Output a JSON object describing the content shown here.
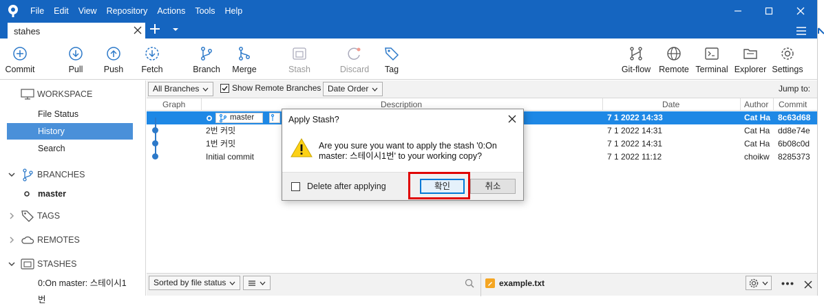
{
  "menu": [
    "File",
    "Edit",
    "View",
    "Repository",
    "Actions",
    "Tools",
    "Help"
  ],
  "tab": {
    "label": "stahes"
  },
  "toolbar": {
    "commit": "Commit",
    "pull": "Pull",
    "push": "Push",
    "fetch": "Fetch",
    "branch": "Branch",
    "merge": "Merge",
    "stash": "Stash",
    "discard": "Discard",
    "tag": "Tag",
    "gitflow": "Git-flow",
    "remote": "Remote",
    "terminal": "Terminal",
    "explorer": "Explorer",
    "settings": "Settings"
  },
  "sidebar": {
    "workspace": "WORKSPACE",
    "file_status": "File Status",
    "history": "History",
    "search": "Search",
    "branches": "BRANCHES",
    "master": "master",
    "tags": "TAGS",
    "remotes": "REMOTES",
    "stashes": "STASHES",
    "stash_item": "0:On master: 스테이시1번"
  },
  "filter": {
    "all_branches": "All Branches",
    "show_remote": "Show Remote Branches",
    "date_order": "Date Order",
    "jump_to": "Jump to:"
  },
  "columns": {
    "graph": "Graph",
    "description": "Description",
    "date": "Date",
    "author": "Author",
    "commit": "Commit"
  },
  "commits": [
    {
      "branch": "master",
      "date": "7 1 2022 14:33",
      "author": "Cat Ha",
      "hash": "8c63d68"
    },
    {
      "description": "2번 커밋",
      "date": "7 1 2022 14:31",
      "author": "Cat Ha",
      "hash": "dd8e74e"
    },
    {
      "description": "1번 커밋",
      "date": "7 1 2022 14:31",
      "author": "Cat Ha",
      "hash": "6b08c0d"
    },
    {
      "description": "Initial commit",
      "date": "7 1 2022 11:12",
      "author": "choikw",
      "hash": "8285373"
    }
  ],
  "bottom": {
    "sort": "Sorted by file status",
    "file": "example.txt"
  },
  "dialog": {
    "title": "Apply Stash?",
    "message": "Are you sure you want to apply the stash '0:On master: 스테이시1번' to your working copy?",
    "delete_after": "Delete after applying",
    "ok": "확인",
    "cancel": "취소"
  },
  "colors": {
    "titlebar": "#1565c0",
    "selection": "#1e88e5",
    "sidebar_selection": "#4a90d9",
    "highlight": "#e00000"
  }
}
